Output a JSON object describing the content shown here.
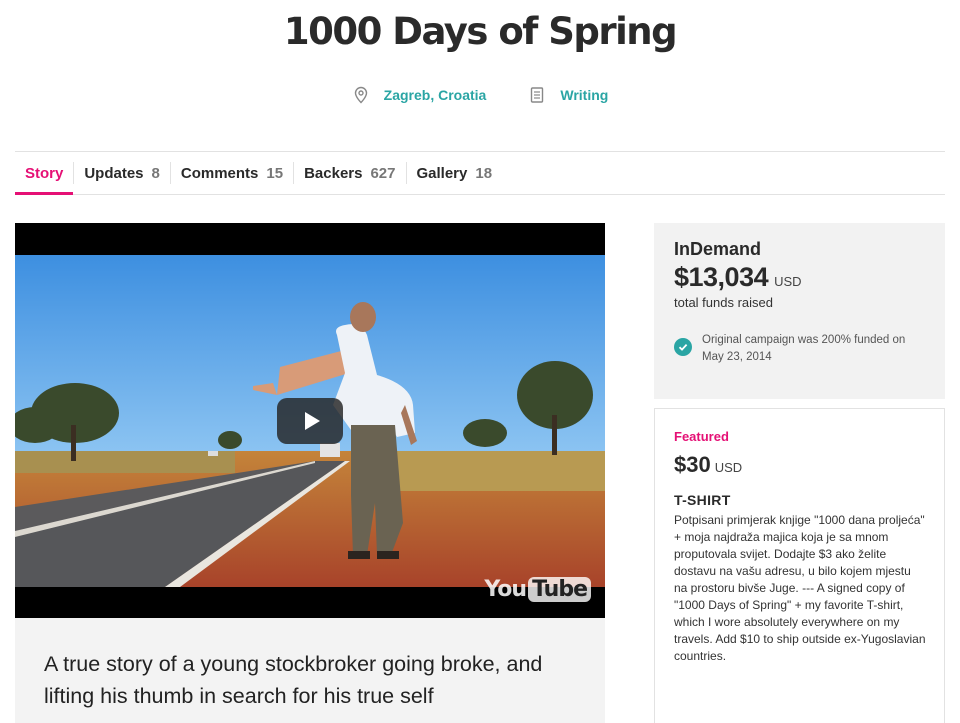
{
  "campaign": {
    "title": "1000 Days of Spring",
    "location": "Zagreb, Croatia",
    "category": "Writing"
  },
  "tabs": [
    {
      "label": "Story",
      "count": ""
    },
    {
      "label": "Updates",
      "count": "8"
    },
    {
      "label": "Comments",
      "count": "15"
    },
    {
      "label": "Backers",
      "count": "627"
    },
    {
      "label": "Gallery",
      "count": "18"
    }
  ],
  "video": {
    "logo_you": "You",
    "logo_tube": "Tube"
  },
  "story": {
    "tagline": "A true story of a young stockbroker going broke, and lifting his thumb in search for his true self"
  },
  "funding": {
    "platform": "InDemand",
    "amount": "$13,034",
    "currency": "USD",
    "raised_label": "total funds raised",
    "original_note": "Original campaign was 200% funded on May 23, 2014"
  },
  "perk": {
    "featured_label": "Featured",
    "price": "$30",
    "currency": "USD",
    "name": "T-SHIRT",
    "description": "Potpisani primjerak knjige \"1000 dana proljeća\" + moja najdraža majica koja je sa mnom proputovala svijet.  Dodajte $3 ako želite dostavu na vašu adresu, u bilo kojem mjestu na prostoru bivše Juge.  ---  A signed copy of \"1000 Days of Spring\" + my favorite T-shirt, which I wore absolutely everywhere on my travels. Add $10 to ship outside ex-Yugoslavian countries."
  },
  "colors": {
    "accent": "#e51075",
    "teal": "#2aa5a4"
  }
}
